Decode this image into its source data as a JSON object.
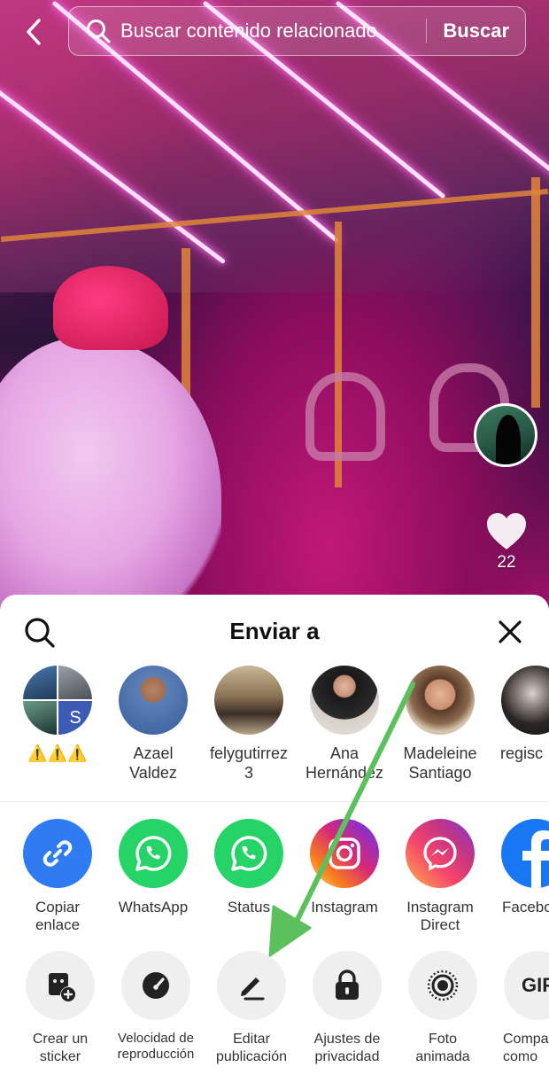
{
  "search": {
    "placeholder": "Buscar contenido relacionado",
    "button": "Buscar"
  },
  "video": {
    "likes": "22"
  },
  "sheet": {
    "title": "Enviar a",
    "contacts": [
      {
        "name": "⚠️⚠️⚠️",
        "avatar": "group-avatar"
      },
      {
        "name": "Azael\nValdez",
        "avatar": "user-avatar"
      },
      {
        "name": "felygutirrez\n3",
        "avatar": "user-avatar"
      },
      {
        "name": "Ana\nHernández",
        "avatar": "user-avatar"
      },
      {
        "name": "Madeleine\nSantiago",
        "avatar": "user-avatar"
      },
      {
        "name": "regisc",
        "avatar": "user-avatar"
      }
    ],
    "share_apps": [
      {
        "label": "Copiar\nenlace",
        "icon": "link-icon",
        "color": "#2f7bf1"
      },
      {
        "label": "WhatsApp",
        "icon": "whatsapp-icon",
        "color": "#25d366"
      },
      {
        "label": "Status",
        "icon": "whatsapp-status-icon",
        "color": "#25d366"
      },
      {
        "label": "Instagram",
        "icon": "instagram-icon",
        "color": "#e1306c"
      },
      {
        "label": "Instagram\nDirect",
        "icon": "messenger-icon",
        "color": "#c13584"
      },
      {
        "label": "Facebo",
        "icon": "facebook-icon",
        "color": "#1877f2"
      }
    ],
    "tools": [
      {
        "label": "Crear un\nsticker",
        "icon": "sticker-icon"
      },
      {
        "label": "Velocidad de\nreproducción",
        "icon": "speed-icon"
      },
      {
        "label": "Editar\npublicación",
        "icon": "edit-icon"
      },
      {
        "label": "Ajustes de\nprivacidad",
        "icon": "lock-icon"
      },
      {
        "label": "Foto\nanimada",
        "icon": "live-photo-icon"
      },
      {
        "label": "Compa\ncomo",
        "icon": "gif-icon",
        "glyph": "GIF"
      }
    ]
  },
  "annotation": {
    "arrow_color": "#5cc15c"
  }
}
